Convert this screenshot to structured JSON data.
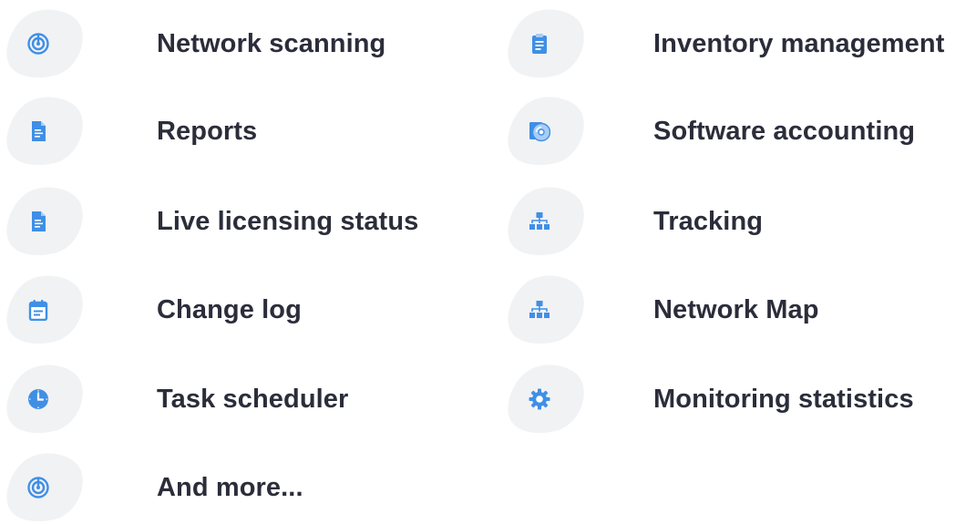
{
  "features": {
    "left": [
      {
        "label": "Network scanning",
        "icon": "radar-icon"
      },
      {
        "label": "Reports",
        "icon": "document-icon"
      },
      {
        "label": "Live licensing status",
        "icon": "document-icon"
      },
      {
        "label": "Change log",
        "icon": "calendar-icon"
      },
      {
        "label": "Task scheduler",
        "icon": "clock-icon"
      },
      {
        "label": "And more...",
        "icon": "radar-icon"
      }
    ],
    "right": [
      {
        "label": "Inventory management",
        "icon": "clipboard-icon"
      },
      {
        "label": "Software accounting",
        "icon": "disc-icon"
      },
      {
        "label": "Tracking",
        "icon": "hierarchy-icon"
      },
      {
        "label": "Network Map",
        "icon": "hierarchy-icon"
      },
      {
        "label": "Monitoring statistics",
        "icon": "gear-icon"
      }
    ]
  },
  "colors": {
    "icon_blue": "#3f8fe6",
    "icon_light": "#cfe4fb",
    "badge_bg": "#f1f2f4",
    "text": "#2b2d3a"
  }
}
